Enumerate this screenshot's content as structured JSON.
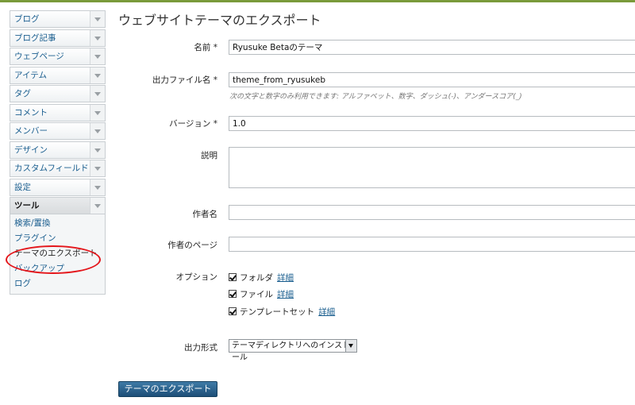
{
  "sidebar": {
    "items": [
      {
        "label": "ブログ"
      },
      {
        "label": "ブログ記事"
      },
      {
        "label": "ウェブページ"
      },
      {
        "label": "アイテム"
      },
      {
        "label": "タグ"
      },
      {
        "label": "コメント"
      },
      {
        "label": "メンバー"
      },
      {
        "label": "デザイン"
      },
      {
        "label": "カスタムフィールド"
      },
      {
        "label": "設定"
      },
      {
        "label": "ツール"
      }
    ],
    "subitems": [
      {
        "label": "検索/置換"
      },
      {
        "label": "プラグイン"
      },
      {
        "label": "テーマのエクスポート"
      },
      {
        "label": "バックアップ"
      },
      {
        "label": "ログ"
      }
    ]
  },
  "main": {
    "title": "ウェブサイトテーマのエクスポート",
    "fields": {
      "name": {
        "label": "名前 *",
        "value": "Ryusuke Betaのテーマ"
      },
      "output_file": {
        "label": "出力ファイル名 *",
        "value": "theme_from_ryusukeb",
        "hint": "次の文字と数字のみ利用できます: アルファベット、数字、ダッシュ(-)、アンダースコア(_)"
      },
      "version": {
        "label": "バージョン *",
        "value": "1.0"
      },
      "description": {
        "label": "説明",
        "value": ""
      },
      "author": {
        "label": "作者名",
        "value": ""
      },
      "author_page": {
        "label": "作者のページ",
        "value": ""
      }
    },
    "options": {
      "label": "オプション",
      "items": [
        {
          "label": "フォルダ",
          "detail": "詳細",
          "checked": true
        },
        {
          "label": "ファイル",
          "detail": "詳細",
          "checked": true
        },
        {
          "label": "テンプレートセット",
          "detail": "詳細",
          "checked": true
        }
      ]
    },
    "output_format": {
      "label": "出力形式",
      "selected": "テーマディレクトリへのインストール"
    },
    "export_button": "テーマのエクスポート"
  },
  "colors": {
    "link": "#1a5e8f",
    "highlight_ring": "#e4161b",
    "button": "#2a6290",
    "top_bar": "#7a9a3a"
  }
}
